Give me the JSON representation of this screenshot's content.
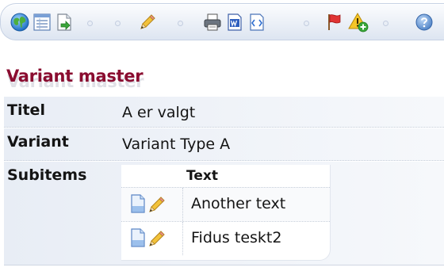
{
  "toolbar": {
    "items": [
      {
        "icon": "globe-icon"
      },
      {
        "icon": "list-icon"
      },
      {
        "icon": "export-icon"
      },
      {
        "icon": "pencil-icon"
      },
      {
        "icon": "print-icon"
      },
      {
        "icon": "word-icon"
      },
      {
        "icon": "xml-icon"
      },
      {
        "icon": "flag-icon"
      },
      {
        "icon": "warning-add-icon"
      },
      {
        "icon": "help-icon"
      }
    ]
  },
  "page": {
    "title": "Variant master"
  },
  "properties": {
    "titel": {
      "label": "Titel",
      "value": "A er valgt"
    },
    "variant": {
      "label": "Variant",
      "value": "Variant Type A"
    },
    "subitems": {
      "label": "Subitems"
    }
  },
  "subitems": {
    "column_header": "Text",
    "rows": [
      {
        "text": "Another text"
      },
      {
        "text": "Fidus teskt2"
      }
    ]
  },
  "colors": {
    "title": "#8a0c30",
    "row_background": "#e8edf5",
    "toolbar_border": "#c7d2e4"
  }
}
